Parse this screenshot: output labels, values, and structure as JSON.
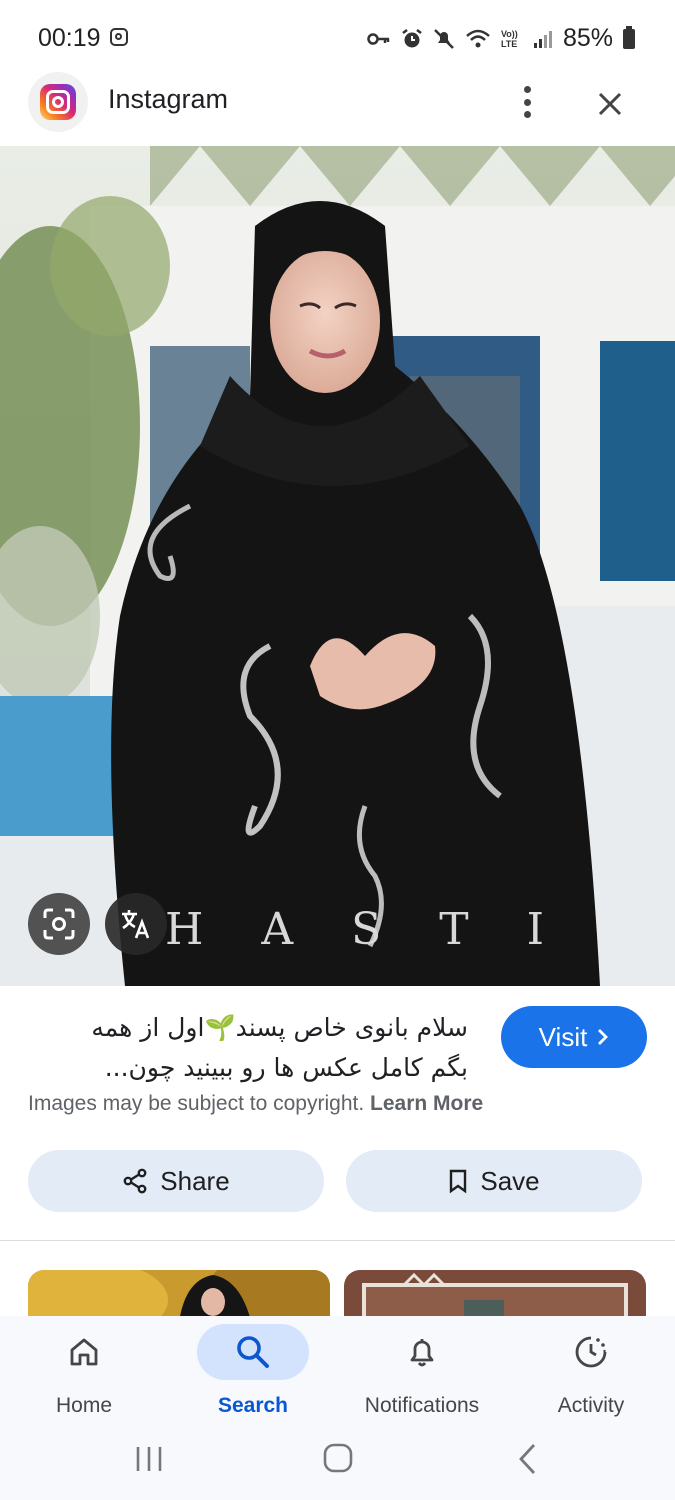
{
  "status_bar": {
    "time": "00:19",
    "lte_label": "Vo)) LTE",
    "battery": "85%"
  },
  "header": {
    "app_name": "Instagram"
  },
  "image": {
    "watermark": "H A S T I"
  },
  "caption": {
    "line1": "سلام بانوی خاص پسند🌱اول از همه",
    "line2": "بگم کامل عکس ها رو ببینید چون..."
  },
  "visit": {
    "label": "Visit"
  },
  "copyright": {
    "text": "Images may be subject to copyright.",
    "learn_more": "Learn More"
  },
  "actions": {
    "share": "Share",
    "save": "Save"
  },
  "bottom_nav": {
    "items": [
      {
        "label": "Home",
        "icon": "home-icon"
      },
      {
        "label": "Search",
        "icon": "search-icon",
        "active": true
      },
      {
        "label": "Notifications",
        "icon": "bell-icon"
      },
      {
        "label": "Activity",
        "icon": "activity-icon"
      }
    ]
  },
  "colors": {
    "accent": "#1a73e8",
    "active_nav": "#0b57d0",
    "chip_bg": "#e3ebf7"
  }
}
